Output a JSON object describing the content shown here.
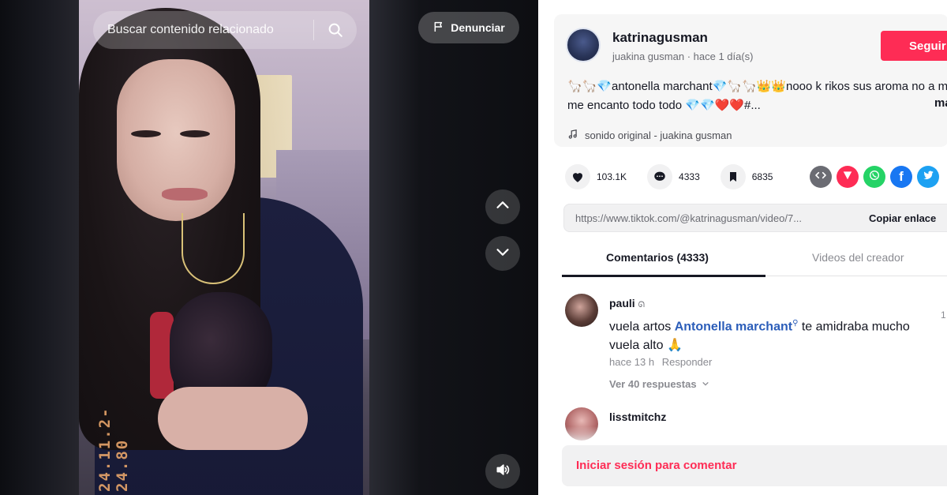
{
  "video": {
    "search_placeholder": "Buscar contenido relacionado",
    "report_label": "Denunciar",
    "date_stamp": "24.11.2-24.80",
    "icons": [
      "search-icon",
      "flag-icon",
      "chevron-up-icon",
      "chevron-down-icon",
      "volume-icon"
    ]
  },
  "post": {
    "username": "katrinagusman",
    "nickname": "juakina gusman",
    "time": "hace 1 día(s)",
    "follow_label": "Seguir",
    "description": "🦙🦙💎antonella marchant💎🦙🦙👑👑nooo k rikos sus aroma no a mi me encanto todo todo 💎💎❤️❤️#...",
    "more_label": "más",
    "sound": "sonido original - juakina gusman"
  },
  "stats": {
    "likes": "103.1K",
    "comments": "4333",
    "saves": "6835"
  },
  "share": {
    "url": "https://www.tiktok.com/@katrinagusman/video/7...",
    "copy_label": "Copiar enlace"
  },
  "tabs": {
    "comments_label": "Comentarios (4333)",
    "creator_videos_label": "Videos del creador"
  },
  "comments": [
    {
      "user": "pauli",
      "text_before": "vuela artos ",
      "mention": "Antonella marchant",
      "text_after": " te amidraba mucho vuela alto 🙏",
      "time": "hace 13 h",
      "reply_label": "Responder",
      "replies_label": "Ver 40 respuestas",
      "like_count": "1"
    },
    {
      "user": "lisstmitchz"
    }
  ],
  "login": {
    "label": "Iniciar sesión para comentar"
  },
  "colors": {
    "brand_red": "#fe2c55",
    "mention_blue": "#2b5db9",
    "text_dark": "#161823",
    "muted": "#8a8b91"
  }
}
